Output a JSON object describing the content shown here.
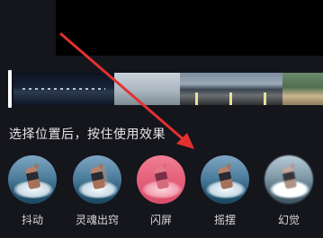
{
  "hint": "选择位置后，按住使用效果",
  "colors": {
    "background": "#15151c",
    "annotation_arrow": "#e53030",
    "playhead": "#ffffff"
  },
  "timeline": {
    "frames": [
      "night-city-frame",
      "surfer-frame",
      "mountain-road-frame",
      "mountain-road-frame",
      "mountain-road-frame",
      "trees-frame"
    ]
  },
  "effects": [
    {
      "label": "抖动",
      "icon": "surfer-thumbnail"
    },
    {
      "label": "灵魂出窍",
      "icon": "surfer-thumbnail"
    },
    {
      "label": "闪屏",
      "icon": "surfer-thumbnail-pink"
    },
    {
      "label": "摇摆",
      "icon": "surfer-thumbnail"
    },
    {
      "label": "幻觉",
      "icon": "surfer-thumbnail"
    }
  ]
}
